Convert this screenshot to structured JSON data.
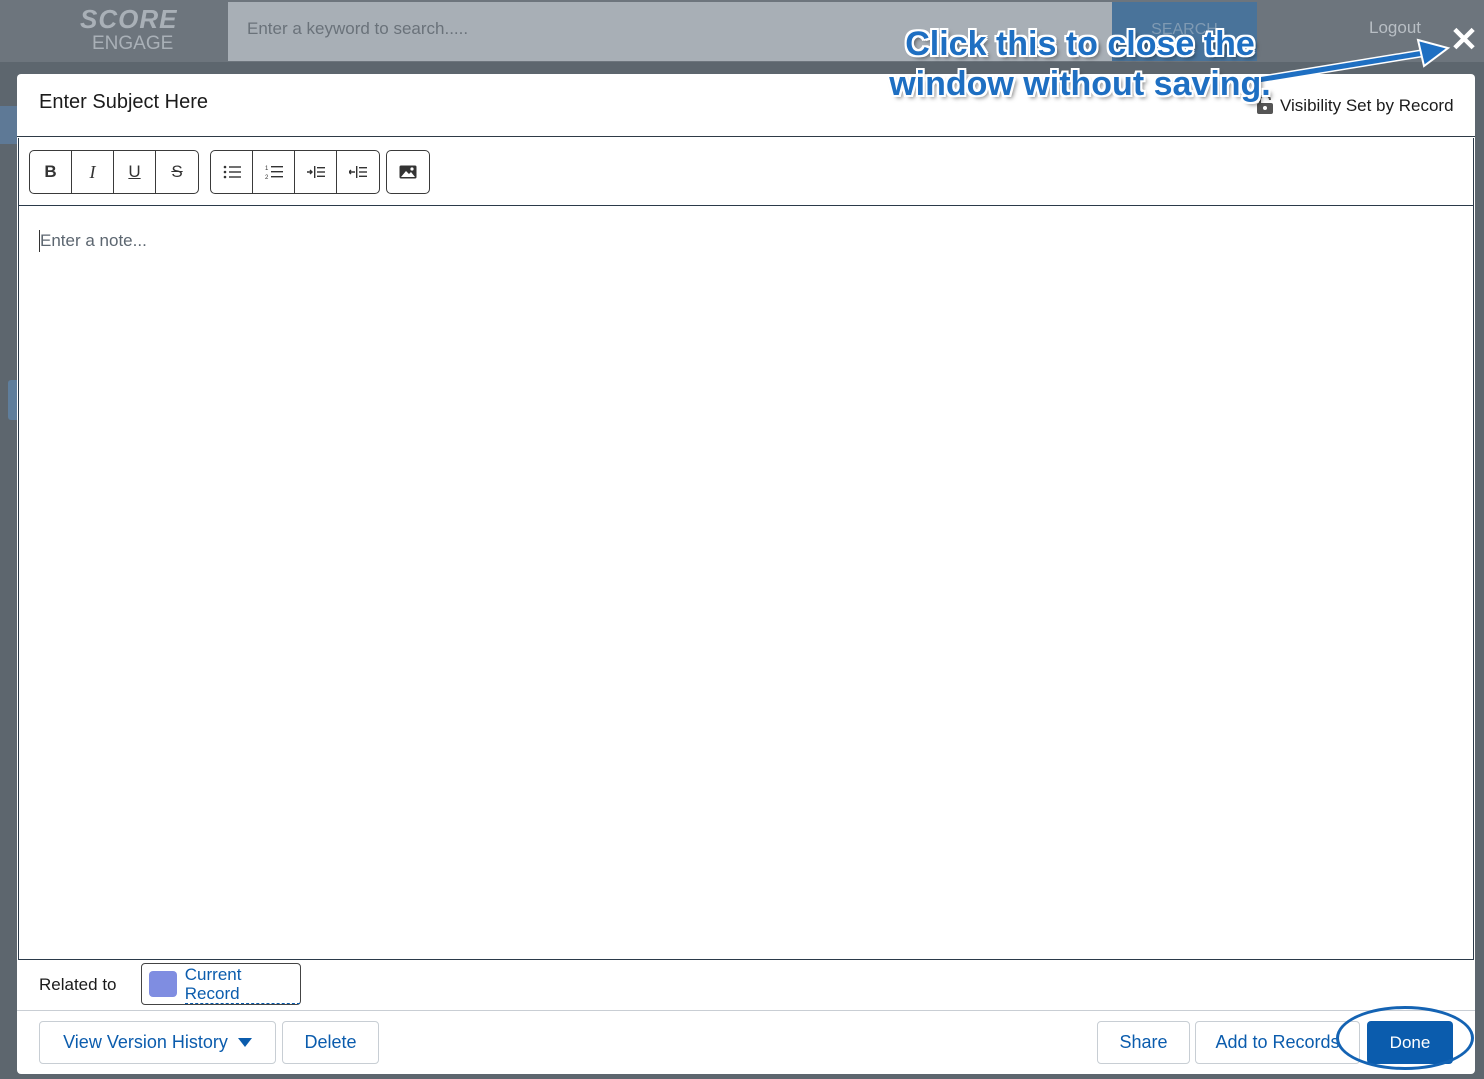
{
  "background": {
    "logo_top": "SCORE",
    "logo_bottom": "ENGAGE",
    "search_placeholder": "Enter a keyword to search.....",
    "search_button": "SEARCH",
    "logout": "Logout"
  },
  "modal": {
    "subject": "Enter Subject Here",
    "visibility": "Visibility Set by Record",
    "toolbar": {
      "format_group": [
        "bold-icon",
        "italic-icon",
        "underline-icon",
        "strikethrough-icon"
      ],
      "list_group": [
        "bulleted-list-icon",
        "numbered-list-icon",
        "indent-icon",
        "outdent-icon"
      ],
      "image_group": [
        "insert-image-icon"
      ]
    },
    "note_placeholder": "Enter a note...",
    "related_label": "Related to",
    "related_record": "Current Record",
    "footer": {
      "version_history": "View Version History",
      "delete": "Delete",
      "share": "Share",
      "add_to_records": "Add to Records",
      "done": "Done"
    }
  },
  "annotation": {
    "callout_line1": "Click this to close the",
    "callout_line2": "window without saving."
  },
  "colors": {
    "accent": "#0b5cad",
    "swatch": "#7f8de1",
    "callout": "#1e6fc2"
  }
}
